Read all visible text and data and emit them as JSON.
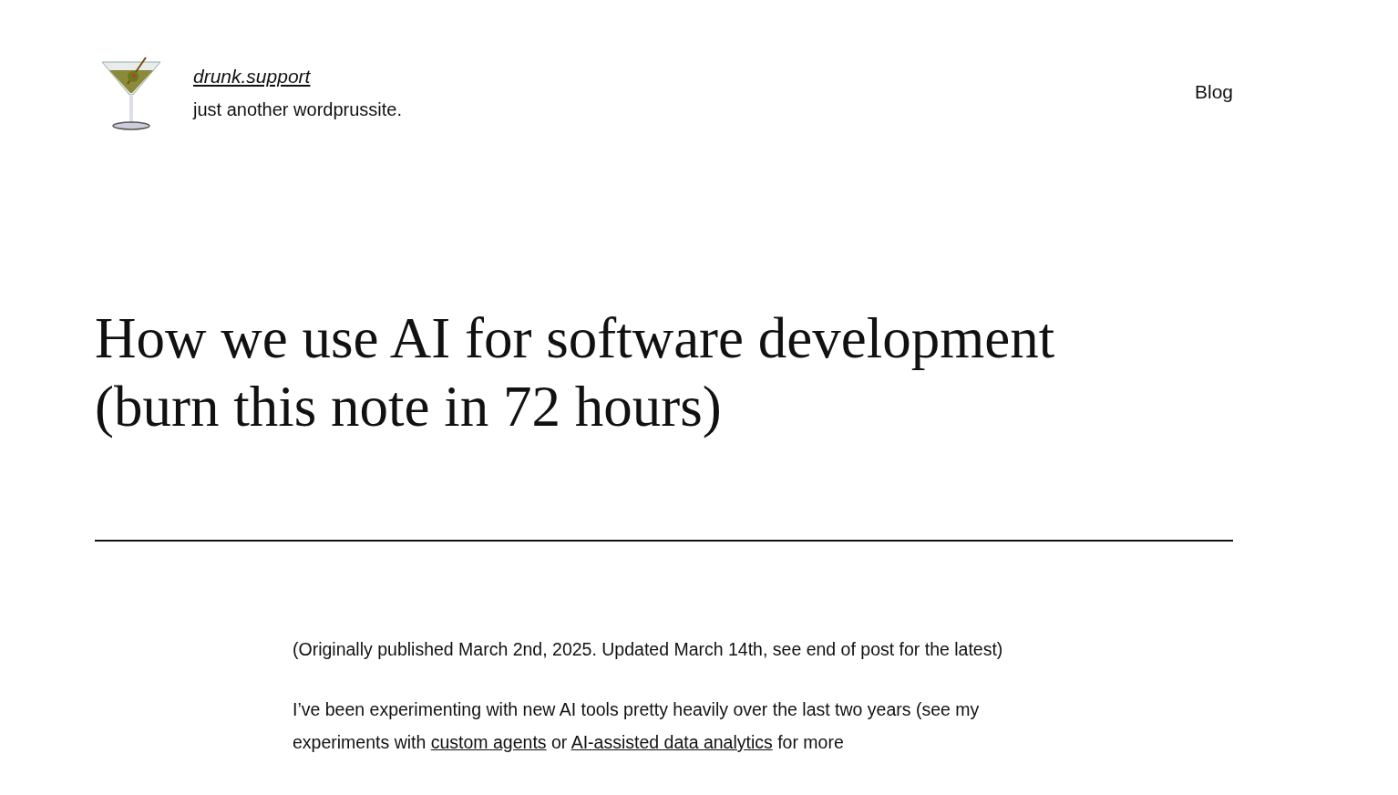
{
  "header": {
    "site_title": "drunk.support",
    "tagline": "just another wordprussite.",
    "nav": [
      {
        "label": "Blog"
      }
    ]
  },
  "post": {
    "title": "How we use AI for software development (burn this note in 72 hours)",
    "paragraphs": [
      [
        {
          "kind": "text",
          "text": "(Originally published March 2nd, 2025. Updated March 14th, see end of post for the latest)"
        }
      ],
      [
        {
          "kind": "text",
          "text": "I’ve been experimenting with new AI tools pretty heavily over the last two years (see my experiments with "
        },
        {
          "kind": "link",
          "text": "custom agents"
        },
        {
          "kind": "text",
          "text": " or "
        },
        {
          "kind": "link",
          "text": "AI-assisted data analytics"
        },
        {
          "kind": "text",
          "text": " for more"
        }
      ]
    ]
  }
}
